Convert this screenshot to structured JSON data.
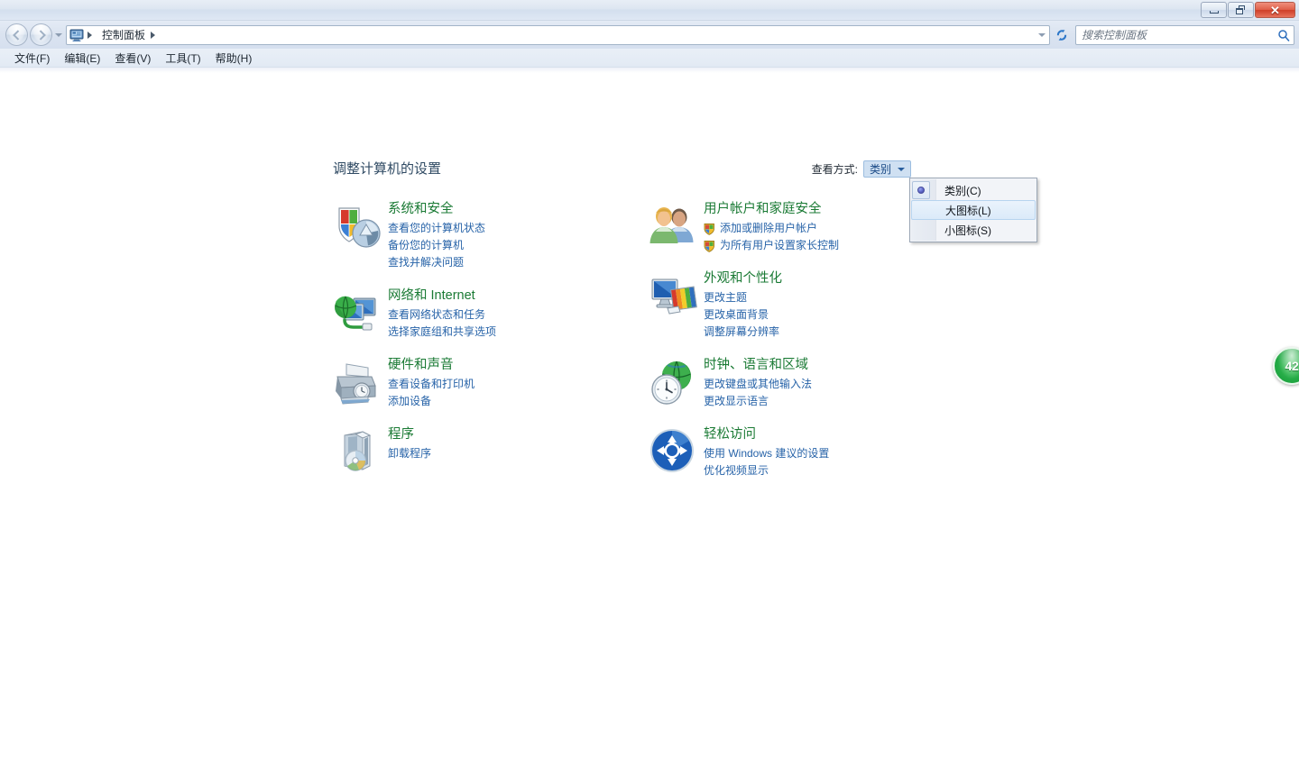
{
  "window": {
    "titlebar": {
      "minimize_label": "最小化",
      "restore_label": "还原",
      "close_label": "关闭"
    }
  },
  "navbar": {
    "back_label": "后退",
    "forward_label": "前进",
    "recent_pages_label": "最近浏览的页面",
    "breadcrumb": {
      "icon": "control-panel-icon",
      "items": [
        "控制面板"
      ]
    },
    "refresh_label": "刷新",
    "search": {
      "placeholder": "搜索控制面板",
      "value": "",
      "icon": "search-icon"
    }
  },
  "menubar": {
    "items": [
      {
        "label": "文件(F)"
      },
      {
        "label": "编辑(E)"
      },
      {
        "label": "查看(V)"
      },
      {
        "label": "工具(T)"
      },
      {
        "label": "帮助(H)"
      }
    ]
  },
  "main": {
    "page_title": "调整计算机的设置",
    "viewby": {
      "label": "查看方式:",
      "selected": "类别",
      "menu": [
        {
          "label": "类别(C)",
          "selected": true,
          "hover": false
        },
        {
          "label": "大图标(L)",
          "selected": false,
          "hover": true
        },
        {
          "label": "小图标(S)",
          "selected": false,
          "hover": false
        }
      ]
    },
    "categories_left": [
      {
        "icon": "security-shield-icon",
        "title": "系统和安全",
        "links": [
          {
            "label": "查看您的计算机状态",
            "shield": false
          },
          {
            "label": "备份您的计算机",
            "shield": false
          },
          {
            "label": "查找并解决问题",
            "shield": false
          }
        ]
      },
      {
        "icon": "network-globe-icon",
        "title": "网络和 Internet",
        "links": [
          {
            "label": "查看网络状态和任务",
            "shield": false
          },
          {
            "label": "选择家庭组和共享选项",
            "shield": false
          }
        ]
      },
      {
        "icon": "printer-hardware-icon",
        "title": "硬件和声音",
        "links": [
          {
            "label": "查看设备和打印机",
            "shield": false
          },
          {
            "label": "添加设备",
            "shield": false
          }
        ]
      },
      {
        "icon": "programs-cd-icon",
        "title": "程序",
        "links": [
          {
            "label": "卸载程序",
            "shield": false
          }
        ]
      }
    ],
    "categories_right": [
      {
        "icon": "user-accounts-icon",
        "title": "用户帐户和家庭安全",
        "links": [
          {
            "label": "添加或删除用户帐户",
            "shield": true
          },
          {
            "label": "为所有用户设置家长控制",
            "shield": true
          }
        ]
      },
      {
        "icon": "appearance-monitor-icon",
        "title": "外观和个性化",
        "links": [
          {
            "label": "更改主题",
            "shield": false
          },
          {
            "label": "更改桌面背景",
            "shield": false
          },
          {
            "label": "调整屏幕分辨率",
            "shield": false
          }
        ]
      },
      {
        "icon": "clock-globe-icon",
        "title": "时钟、语言和区域",
        "links": [
          {
            "label": "更改键盘或其他输入法",
            "shield": false
          },
          {
            "label": "更改显示语言",
            "shield": false
          }
        ]
      },
      {
        "icon": "ease-of-access-icon",
        "title": "轻松访问",
        "links": [
          {
            "label": "使用 Windows 建议的设置",
            "shield": false
          },
          {
            "label": "优化视频显示",
            "shield": false
          }
        ]
      }
    ]
  },
  "overlay_badge": {
    "value": "42",
    "color": "#23a945"
  },
  "colors": {
    "category_title": "#1a7a34",
    "link": "#2763a8",
    "page_title": "#2f4a63",
    "accent": "#cfe0f2"
  }
}
